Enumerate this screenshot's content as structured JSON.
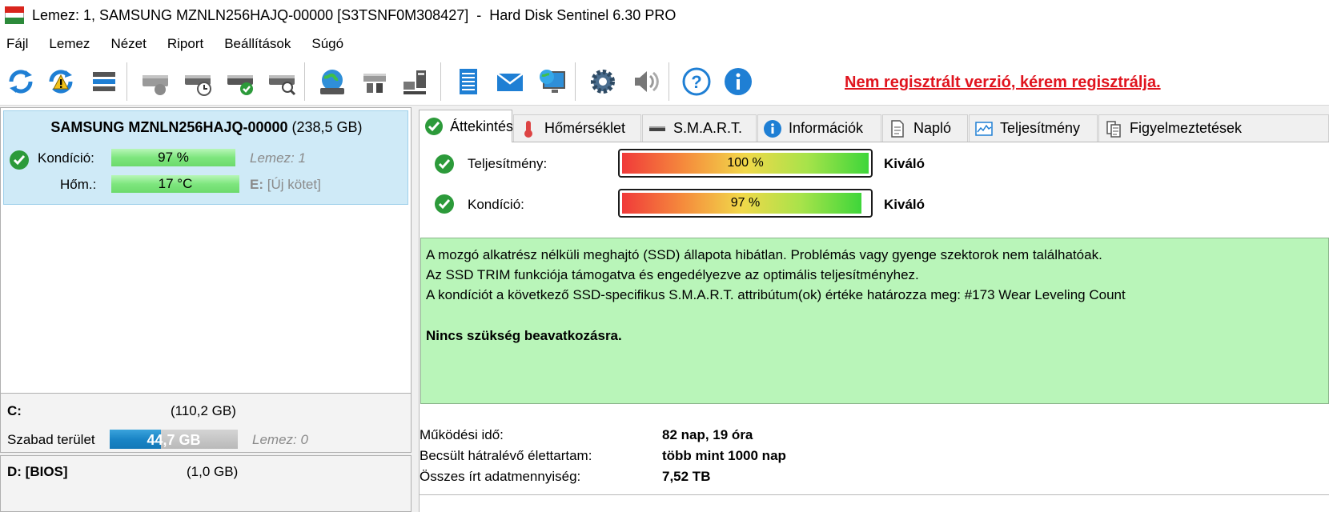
{
  "window": {
    "title": "Lemez: 1, SAMSUNG MZNLN256HAJQ-00000 [S3TSNF0M308427]  -  Hard Disk Sentinel 6.30 PRO"
  },
  "menu": [
    {
      "label": "Fájl"
    },
    {
      "label": "Lemez"
    },
    {
      "label": "Nézet"
    },
    {
      "label": "Riport"
    },
    {
      "label": "Beállítások"
    },
    {
      "label": "Súgó"
    }
  ],
  "toolbar": {
    "icons": [
      "refresh-icon",
      "refresh-warning-icon",
      "disk-list-icon",
      "disk-icon",
      "disk-clock-icon",
      "disk-check-icon",
      "disk-search-icon",
      "globe-icon",
      "network-disk-icon",
      "network-computer-icon",
      "report-icon",
      "mail-icon",
      "monitor-globe-icon",
      "gear-icon",
      "speaker-icon",
      "help-icon",
      "info-icon"
    ],
    "register_label": "Nem regisztrált verzió, kérem regisztrálja."
  },
  "disk": {
    "name": "SAMSUNG MZNLN256HAJQ-00000",
    "size": "(238,5 GB)",
    "condition_label": "Kondíció:",
    "condition_value": "97 %",
    "condition_fraction": 0.97,
    "disk_index": "Lemez: 1",
    "temp_label": "Hőm.:",
    "temp_value": "17 °C",
    "volume_letter": "E:",
    "volume_name": "[Új kötet]"
  },
  "volumes": [
    {
      "letter": "C:",
      "size": "(110,2 GB)",
      "free_label": "Szabad terület",
      "free_value": "44,7 GB",
      "free_fraction": 0.4,
      "disk": "Lemez: 0"
    },
    {
      "letter": "D: [BIOS]",
      "size": "(1,0 GB)"
    }
  ],
  "tabs": [
    {
      "label": "Áttekintés",
      "icon": "check-circle-icon",
      "active": true
    },
    {
      "label": "Hőmérséklet",
      "icon": "thermometer-icon"
    },
    {
      "label": "S.M.A.R.T.",
      "icon": "smart-icon"
    },
    {
      "label": "Információk",
      "icon": "info-icon"
    },
    {
      "label": "Napló",
      "icon": "document-icon"
    },
    {
      "label": "Teljesítmény",
      "icon": "performance-chart-icon"
    },
    {
      "label": "Figyelmeztetések",
      "icon": "alerts-icon"
    }
  ],
  "overview": {
    "performance_label": "Teljesítmény:",
    "performance_value": "100 %",
    "performance_fraction": 1.0,
    "performance_rating": "Kiváló",
    "condition_label": "Kondíció:",
    "condition_value": "97 %",
    "condition_fraction": 0.97,
    "condition_rating": "Kiváló",
    "message_lines": [
      "A mozgó alkatrész nélküli meghajtó (SSD) állapota hibátlan. Problémás vagy gyenge szektorok nem találhatóak.",
      "Az SSD TRIM funkciója támogatva és engedélyezve az optimális teljesítményhez.",
      "A kondíciót a következő SSD-specifikus S.M.A.R.T. attribútum(ok) értéke határozza meg:  #173 Wear Leveling Count"
    ],
    "message_action": "Nincs szükség beavatkozásra.",
    "stats": [
      {
        "label": "Működési idő:",
        "value": "82 nap, 19 óra"
      },
      {
        "label": "Becsült hátralévő élettartam:",
        "value": "több mint 1000 nap"
      },
      {
        "label": "Összes írt adatmennyiség:",
        "value": "7,52 TB"
      }
    ]
  },
  "colors": {
    "accent_red": "#e0141e",
    "ok_green": "#2c9a3a",
    "selection_blue": "#cfeaf7",
    "message_green": "#b9f5b9",
    "free_space_blue": "#1a85c6"
  }
}
